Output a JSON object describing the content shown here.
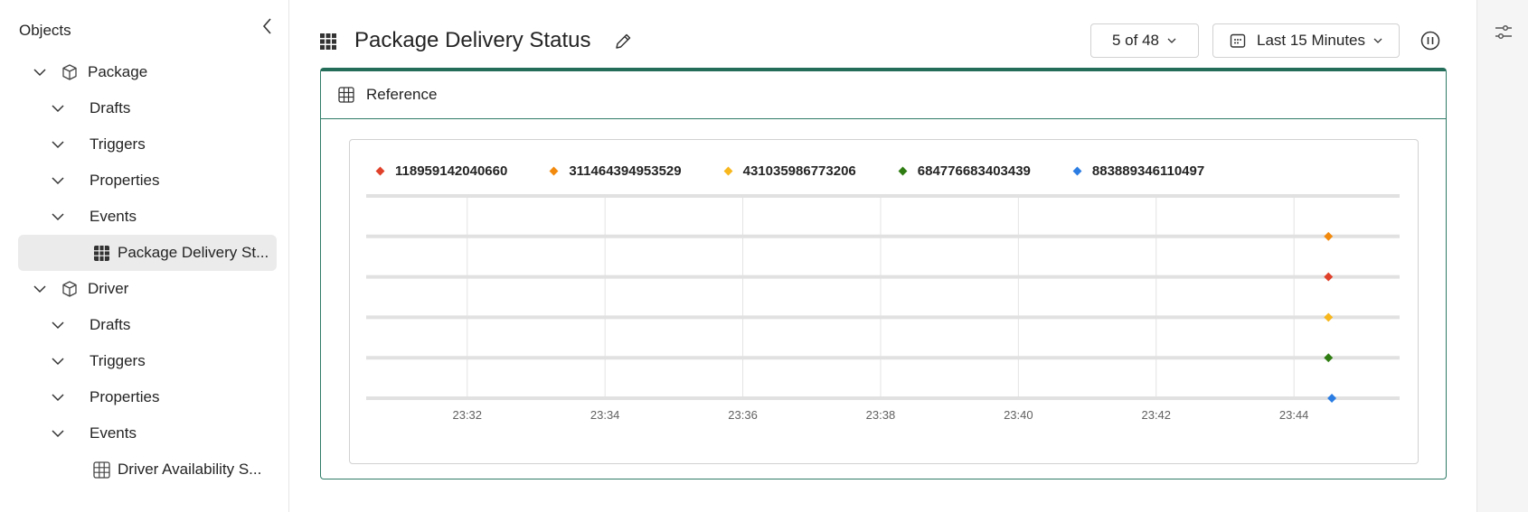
{
  "sidebar": {
    "title": "Objects",
    "tree": [
      {
        "label": "Package",
        "level": 0,
        "kind": "object"
      },
      {
        "label": "Drafts",
        "level": 1,
        "kind": "folder"
      },
      {
        "label": "Triggers",
        "level": 1,
        "kind": "folder"
      },
      {
        "label": "Properties",
        "level": 1,
        "kind": "folder"
      },
      {
        "label": "Events",
        "level": 1,
        "kind": "folder"
      },
      {
        "label": "Package Delivery St...",
        "level": 2,
        "kind": "table",
        "selected": true
      },
      {
        "label": "Driver",
        "level": 0,
        "kind": "object"
      },
      {
        "label": "Drafts",
        "level": 1,
        "kind": "folder"
      },
      {
        "label": "Triggers",
        "level": 1,
        "kind": "folder"
      },
      {
        "label": "Properties",
        "level": 1,
        "kind": "folder"
      },
      {
        "label": "Events",
        "level": 1,
        "kind": "folder"
      },
      {
        "label": "Driver Availability S...",
        "level": 2,
        "kind": "table"
      }
    ]
  },
  "header": {
    "title": "Package Delivery Status",
    "count_label": "5 of 48",
    "time_label": "Last 15 Minutes"
  },
  "card": {
    "title": "Reference"
  },
  "colors": {
    "accent": "#236d59",
    "red": "#e0412a",
    "orange": "#f28a0e",
    "yellow": "#f7b71d",
    "green": "#2f7d12",
    "blue": "#2b7de3"
  },
  "chart_data": {
    "type": "scatter",
    "x_ticks": [
      "23:32",
      "23:34",
      "23:36",
      "23:38",
      "23:40",
      "23:42",
      "23:44"
    ],
    "xlim": [
      "23:30:32",
      "23:45:32"
    ],
    "series": [
      {
        "name": "118959142040660",
        "color": "#e0412a",
        "lane": 2,
        "x": [
          "23:44:30"
        ]
      },
      {
        "name": "311464394953529",
        "color": "#f28a0e",
        "lane": 1,
        "x": [
          "23:44:30"
        ]
      },
      {
        "name": "431035986773206",
        "color": "#f7b71d",
        "lane": 3,
        "x": [
          "23:44:30"
        ]
      },
      {
        "name": "684776683403439",
        "color": "#2f7d12",
        "lane": 4,
        "x": [
          "23:44:30"
        ]
      },
      {
        "name": "883889346110497",
        "color": "#2b7de3",
        "lane": 5,
        "x": [
          "23:44:33"
        ]
      }
    ],
    "lanes": 6,
    "grid": true,
    "legend": "top-left"
  }
}
